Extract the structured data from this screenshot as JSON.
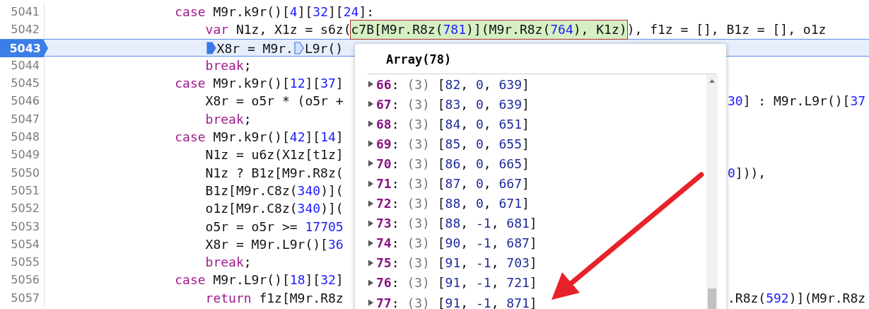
{
  "code_lines": [
    {
      "number": "5041",
      "current": false,
      "left": [
        {
          "kind": "keyword",
          "text": "case"
        },
        {
          "kind": "plain",
          "text": " M9r.k9r()["
        },
        {
          "kind": "number",
          "text": "4"
        },
        {
          "kind": "plain",
          "text": "]["
        },
        {
          "kind": "number",
          "text": "32"
        },
        {
          "kind": "plain",
          "text": "]["
        },
        {
          "kind": "number",
          "text": "24"
        },
        {
          "kind": "plain",
          "text": "]:"
        }
      ],
      "children": [
        {
          "number": "5042",
          "current": false,
          "left": [
            {
              "kind": "keyword",
              "text": "var"
            },
            {
              "kind": "plain",
              "text": " N1z, X1z = s6z("
            },
            {
              "kind": "expression",
              "hovered": true,
              "tokens": [
                {
                  "kind": "plain",
                  "text": "c7B[M9r.R8z("
                },
                {
                  "kind": "number",
                  "text": "781"
                },
                {
                  "kind": "plain",
                  "text": ")](M9r.R8z("
                },
                {
                  "kind": "number",
                  "text": "764"
                },
                {
                  "kind": "plain",
                  "text": "), K1z)"
                }
              ]
            },
            {
              "kind": "plain",
              "text": "), f1z = [], B1z = [], o1z"
            }
          ]
        },
        {
          "number": "5043",
          "current": true,
          "left": [
            {
              "kind": "marker",
              "active": true
            },
            {
              "kind": "plain",
              "text": "X8r = M9r."
            },
            {
              "kind": "marker",
              "active": false
            },
            {
              "kind": "plain",
              "text": "L9r()"
            }
          ]
        },
        {
          "number": "5044",
          "current": false,
          "left": [
            {
              "kind": "keyword",
              "text": "break"
            },
            {
              "kind": "plain",
              "text": ";"
            }
          ]
        }
      ]
    },
    {
      "number": "5045",
      "current": false,
      "left": [
        {
          "kind": "keyword",
          "text": "case"
        },
        {
          "kind": "plain",
          "text": " M9r.k9r()["
        },
        {
          "kind": "number",
          "text": "12"
        },
        {
          "kind": "plain",
          "text": "]["
        },
        {
          "kind": "number",
          "text": "37"
        },
        {
          "kind": "plain",
          "text": "]"
        }
      ],
      "children": [
        {
          "number": "5046",
          "current": false,
          "left": [
            {
              "kind": "plain",
              "text": "X8r = o5r * (o5r +"
            }
          ],
          "right": [
            {
              "kind": "number",
              "text": "30"
            },
            {
              "kind": "plain",
              "text": "] : M9r.L9r()["
            },
            {
              "kind": "number",
              "text": "37"
            }
          ]
        },
        {
          "number": "5047",
          "current": false,
          "left": [
            {
              "kind": "keyword",
              "text": "break"
            },
            {
              "kind": "plain",
              "text": ";"
            }
          ]
        }
      ]
    },
    {
      "number": "5048",
      "current": false,
      "left": [
        {
          "kind": "keyword",
          "text": "case"
        },
        {
          "kind": "plain",
          "text": " M9r.k9r()["
        },
        {
          "kind": "number",
          "text": "42"
        },
        {
          "kind": "plain",
          "text": "]["
        },
        {
          "kind": "number",
          "text": "14"
        },
        {
          "kind": "plain",
          "text": "]"
        }
      ],
      "children": [
        {
          "number": "5049",
          "current": false,
          "left": [
            {
              "kind": "plain",
              "text": "N1z = u6z(X1z[t1z]"
            }
          ]
        },
        {
          "number": "5050",
          "current": false,
          "left": [
            {
              "kind": "plain",
              "text": "N1z ? B1z[M9r.R8z("
            }
          ],
          "right": [
            {
              "kind": "number",
              "text": "0"
            },
            {
              "kind": "plain",
              "text": "])),"
            }
          ]
        },
        {
          "number": "5051",
          "current": false,
          "left": [
            {
              "kind": "plain",
              "text": "B1z[M9r.C8z("
            },
            {
              "kind": "number",
              "text": "340"
            },
            {
              "kind": "plain",
              "text": ")]("
            }
          ]
        },
        {
          "number": "5052",
          "current": false,
          "left": [
            {
              "kind": "plain",
              "text": "o1z[M9r.C8z("
            },
            {
              "kind": "number",
              "text": "340"
            },
            {
              "kind": "plain",
              "text": ")]("
            }
          ]
        },
        {
          "number": "5053",
          "current": false,
          "left": [
            {
              "kind": "plain",
              "text": "o5r = o5r >= "
            },
            {
              "kind": "number",
              "text": "17705"
            }
          ]
        },
        {
          "number": "5054",
          "current": false,
          "left": [
            {
              "kind": "plain",
              "text": "X8r = M9r.L9r()["
            },
            {
              "kind": "number",
              "text": "36"
            }
          ]
        },
        {
          "number": "5055",
          "current": false,
          "left": [
            {
              "kind": "keyword",
              "text": "break"
            },
            {
              "kind": "plain",
              "text": ";"
            }
          ]
        }
      ]
    },
    {
      "number": "5056",
      "current": false,
      "left": [
        {
          "kind": "keyword",
          "text": "case"
        },
        {
          "kind": "plain",
          "text": " M9r.L9r()["
        },
        {
          "kind": "number",
          "text": "18"
        },
        {
          "kind": "plain",
          "text": "]["
        },
        {
          "kind": "number",
          "text": "32"
        },
        {
          "kind": "plain",
          "text": "]"
        }
      ],
      "children": [
        {
          "number": "5057",
          "current": false,
          "left": [
            {
              "kind": "keyword",
              "text": "return"
            },
            {
              "kind": "plain",
              "text": " f1z[M9r.R8z"
            }
          ],
          "right": [
            {
              "kind": "plain",
              "text": ".R8z("
            },
            {
              "kind": "number",
              "text": "592"
            },
            {
              "kind": "plain",
              "text": ")](M9r.R8z"
            }
          ]
        }
      ]
    }
  ],
  "popover": {
    "title": "Array(78)",
    "entries": [
      {
        "label": "66:",
        "length": "(3)",
        "value": "[82, 0, 639]",
        "expanded": false
      },
      {
        "label": "67:",
        "length": "(3)",
        "value": "[83, 0, 639]",
        "expanded": false
      },
      {
        "label": "68:",
        "length": "(3)",
        "value": "[84, 0, 651]",
        "expanded": false
      },
      {
        "label": "69:",
        "length": "(3)",
        "value": "[85, 0, 655]",
        "expanded": false
      },
      {
        "label": "70:",
        "length": "(3)",
        "value": "[86, 0, 665]",
        "expanded": false
      },
      {
        "label": "71:",
        "length": "(3)",
        "value": "[87, 0, 667]",
        "expanded": false
      },
      {
        "label": "72:",
        "length": "(3)",
        "value": "[88, 0, 671]",
        "expanded": false
      },
      {
        "label": "73:",
        "length": "(3)",
        "value": "[88, -1, 681]",
        "expanded": false
      },
      {
        "label": "74:",
        "length": "(3)",
        "value": "[90, -1, 687]",
        "expanded": false
      },
      {
        "label": "75:",
        "length": "(3)",
        "value": "[91, -1, 703]",
        "expanded": false
      },
      {
        "label": "76:",
        "length": "(3)",
        "value": "[91, -1, 721]",
        "expanded": false
      },
      {
        "label": "77:",
        "length": "(3)",
        "value": "[91, -1, 871]",
        "expanded": false
      }
    ]
  }
}
